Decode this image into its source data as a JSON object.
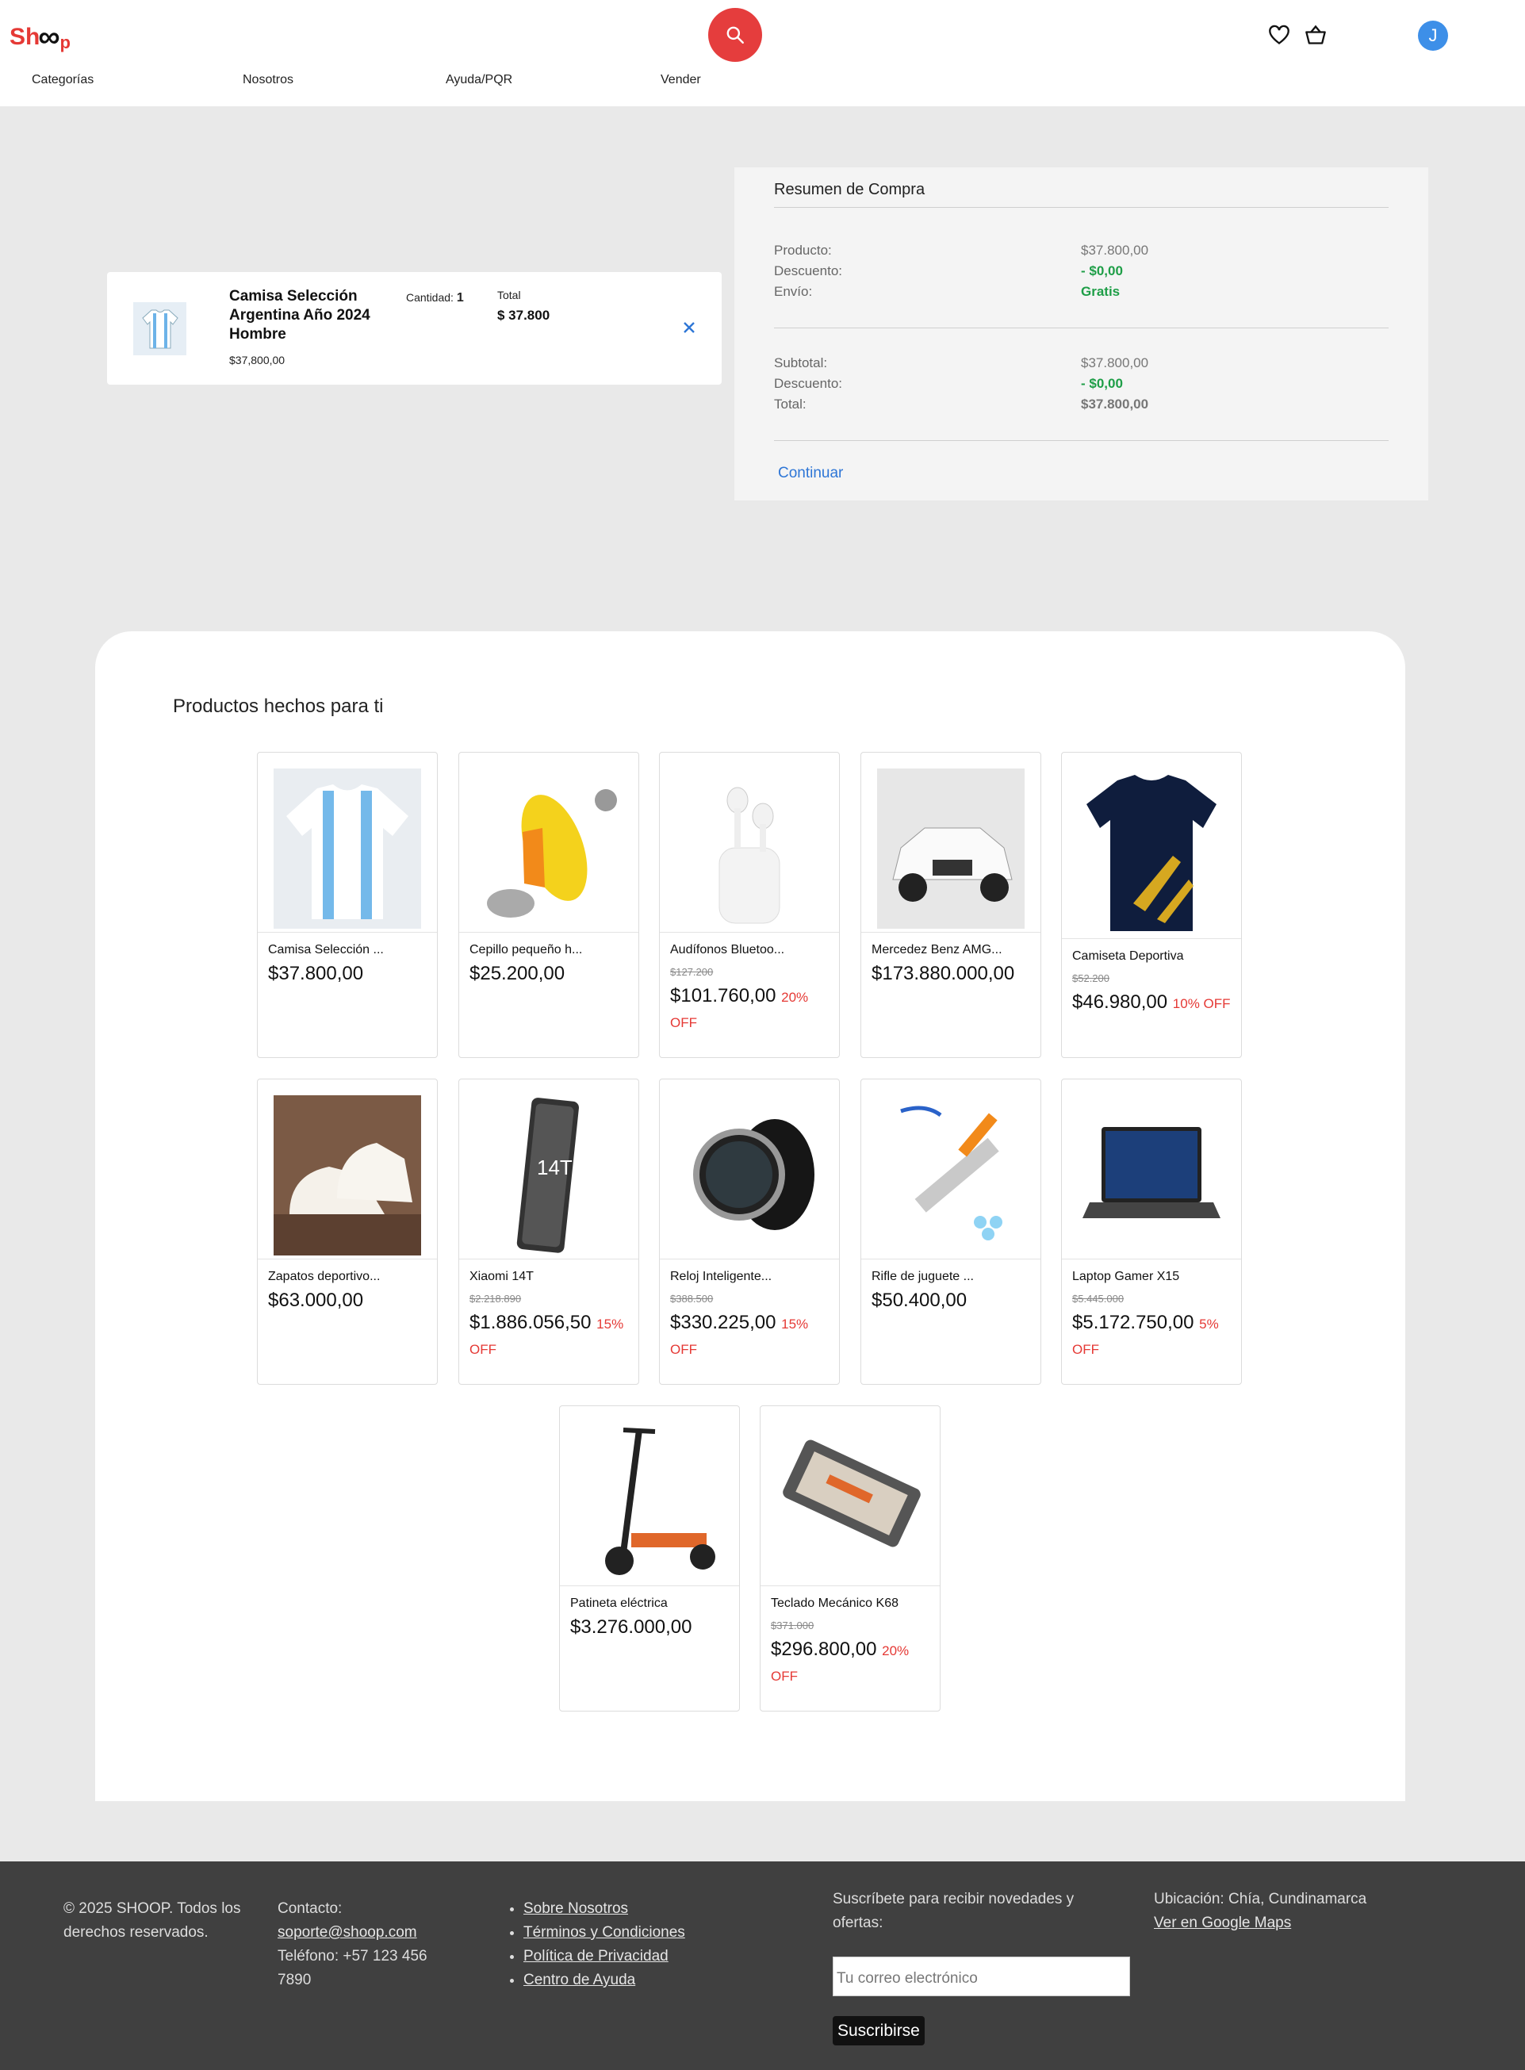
{
  "header": {
    "logo": {
      "a": "Sh",
      "b": "∞",
      "c": "p"
    },
    "nav": [
      "Categorías",
      "Nosotros",
      "Ayuda/PQR",
      "Vender"
    ],
    "avatar_initial": "J"
  },
  "cart": {
    "item_name": "Camisa Selección Argentina Año 2024 Hombre",
    "item_price": "$37,800,00",
    "quantity_label": "Cantidad:",
    "quantity_value": "1",
    "total_label": "Total",
    "total_value": "$ 37.800"
  },
  "summary": {
    "title": "Resumen de Compra",
    "producto_label": "Producto:",
    "producto_value": "$37.800,00",
    "descuento_label": "Descuento:",
    "descuento_value": "- $0,00",
    "envio_label": "Envío:",
    "envio_value": "Gratis",
    "subtotal_label": "Subtotal:",
    "subtotal_value": "$37.800,00",
    "descuento2_label": "Descuento:",
    "descuento2_value": "- $0,00",
    "total_label": "Total:",
    "total_value": "$37.800,00",
    "continue_label": "Continuar"
  },
  "recommendations": {
    "title": "Productos hechos para ti",
    "products": [
      {
        "name": "Camisa Selección ...",
        "price": "$37.800,00",
        "old_price": "",
        "discount": ""
      },
      {
        "name": "Cepillo pequeño h...",
        "price": "$25.200,00",
        "old_price": "",
        "discount": ""
      },
      {
        "name": "Audífonos Bluetoo...",
        "price": "$101.760,00",
        "old_price": "$127.200",
        "discount": "20% OFF"
      },
      {
        "name": "Mercedez Benz AMG...",
        "price": "$173.880.000,00",
        "old_price": "",
        "discount": ""
      },
      {
        "name": "Camiseta Deportiva",
        "price": "$46.980,00",
        "old_price": "$52.200",
        "discount": "10% OFF"
      },
      {
        "name": "Zapatos deportivo...",
        "price": "$63.000,00",
        "old_price": "",
        "discount": ""
      },
      {
        "name": "Xiaomi 14T",
        "price": "$1.886.056,50",
        "old_price": "$2.218.890",
        "discount": "15% OFF"
      },
      {
        "name": "Reloj Inteligente...",
        "price": "$330.225,00",
        "old_price": "$388.500",
        "discount": "15% OFF"
      },
      {
        "name": "Rifle de juguete ...",
        "price": "$50.400,00",
        "old_price": "",
        "discount": ""
      },
      {
        "name": "Laptop Gamer X15",
        "price": "$5.172.750,00",
        "old_price": "$5.445.000",
        "discount": "5% OFF"
      },
      {
        "name": "Patineta eléctrica",
        "price": "$3.276.000,00",
        "old_price": "",
        "discount": ""
      },
      {
        "name": "Teclado Mecánico K68",
        "price": "$296.800,00",
        "old_price": "$371.000",
        "discount": "20% OFF"
      }
    ]
  },
  "footer": {
    "copyright": "© 2025 SHOOP. Todos los derechos reservados.",
    "contact_label": "Contacto:",
    "contact_email": "soporte@shoop.com",
    "phone": "Teléfono: +57 123 456 7890",
    "links": [
      "Sobre Nosotros",
      "Términos y Condiciones",
      "Política de Privacidad",
      "Centro de Ayuda"
    ],
    "subscribe_text": "Suscríbete para recibir novedades y ofertas:",
    "email_placeholder": "Tu correo electrónico",
    "subscribe_button": "Suscribirse",
    "location": "Ubicación: Chía, Cundinamarca",
    "maps_link": "Ver en Google Maps"
  },
  "colors": {
    "accent": "#e53d3d",
    "link": "#2e76d6",
    "green": "#1e9e47",
    "footer_bg": "#404040"
  }
}
